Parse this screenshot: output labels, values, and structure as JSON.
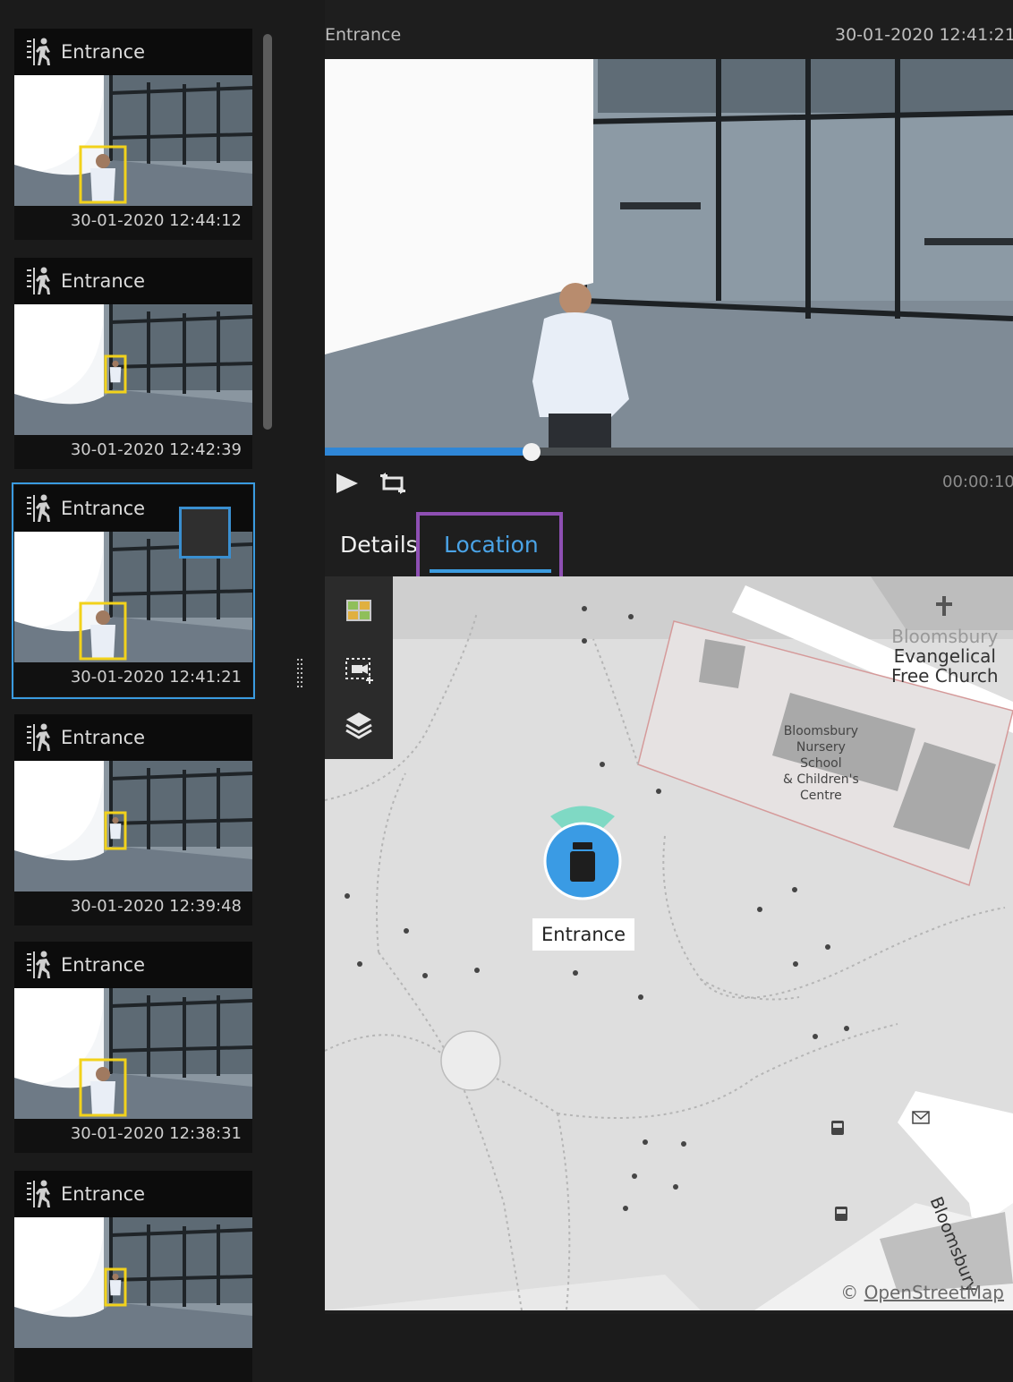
{
  "events": [
    {
      "title": "Entrance",
      "time": "30-01-2020 12:44:12",
      "selected": false
    },
    {
      "title": "Entrance",
      "time": "30-01-2020 12:42:39",
      "selected": false
    },
    {
      "title": "Entrance",
      "time": "30-01-2020 12:41:21",
      "selected": true
    },
    {
      "title": "Entrance",
      "time": "30-01-2020 12:39:48",
      "selected": false
    },
    {
      "title": "Entrance",
      "time": "30-01-2020 12:38:31",
      "selected": false
    },
    {
      "title": "Entrance",
      "time": "",
      "selected": false
    }
  ],
  "player": {
    "camera_name": "Entrance",
    "timestamp": "30-01-2020 12:41:21",
    "progress": 0.3,
    "duration": "00:00:10",
    "play_icon": "play-icon",
    "loop_icon": "loop-icon"
  },
  "tabs": {
    "details": "Details",
    "location": "Location",
    "active": "location",
    "highlight_color": "#8e4fb3",
    "accent_color": "#3c9ce0"
  },
  "map": {
    "tools": [
      "map-grid-icon",
      "camera-select-icon",
      "layers-icon"
    ],
    "labels": {
      "church": "Bloomsbury\nEvangelical\nFree Church",
      "church_top": "Bloomsbury",
      "church_line2": "Evangelical",
      "church_line3": "Free Church",
      "school_1": "Bloomsbury",
      "school_2": "Nursery",
      "school_3": "School",
      "school_4": "& Children's",
      "school_5": "Centre",
      "street": "Bloomsbury"
    },
    "camera_label": "Entrance",
    "attribution_prefix": "©",
    "attribution_link": "OpenStreetMap"
  }
}
